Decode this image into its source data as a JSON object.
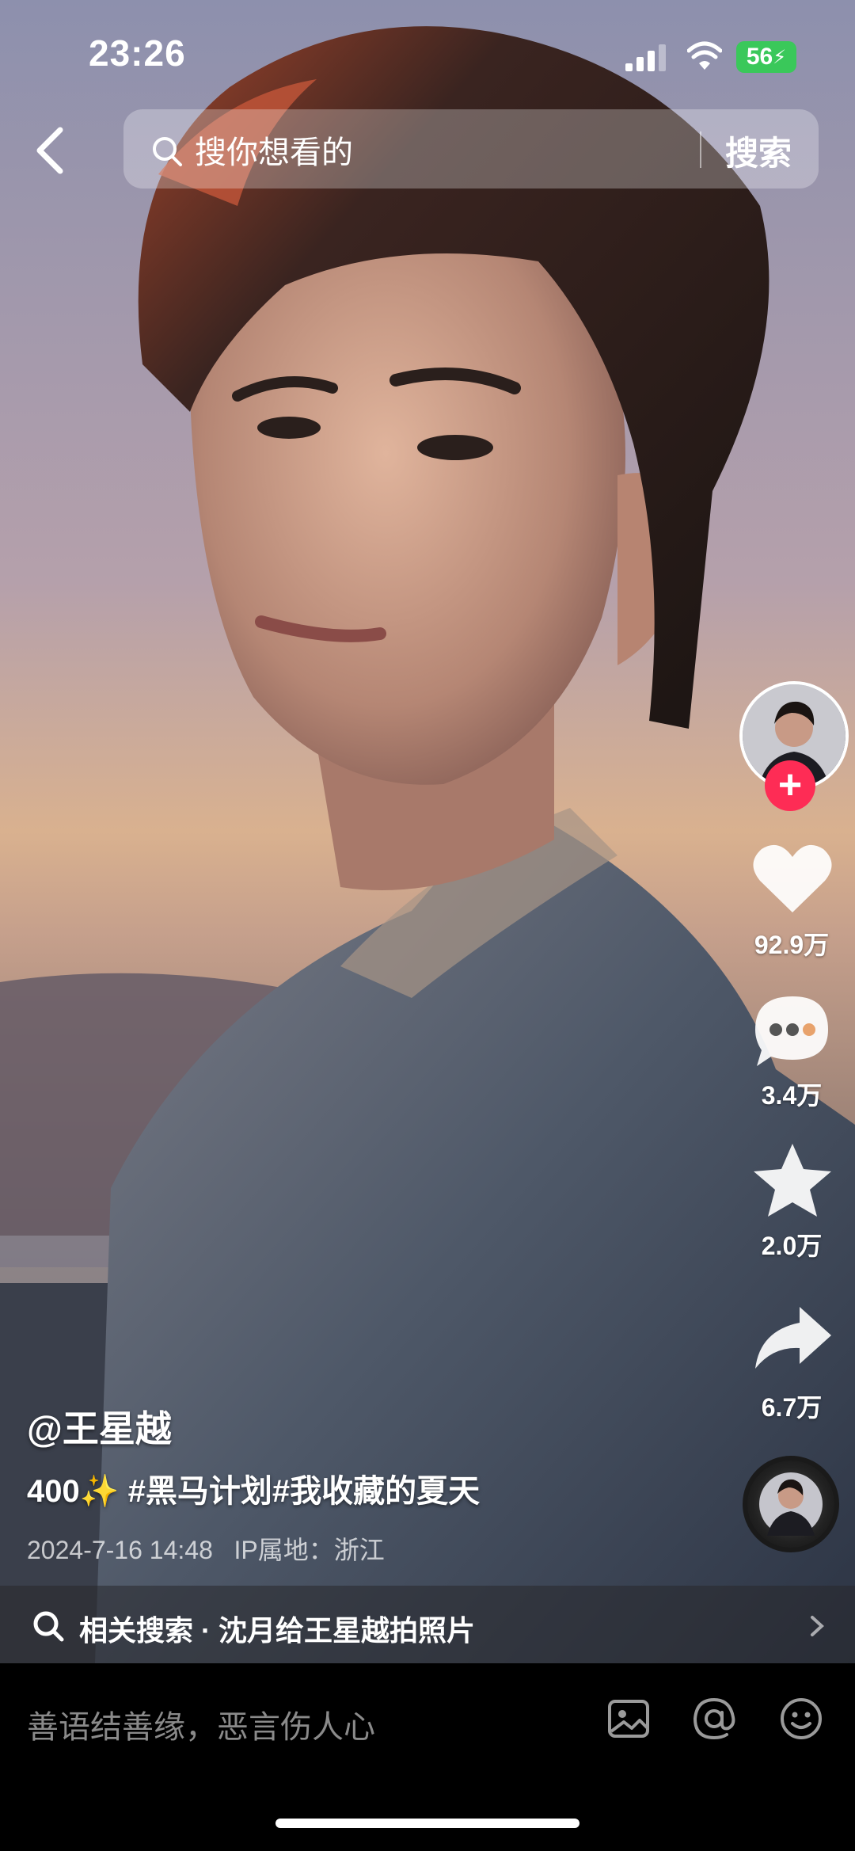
{
  "status_bar": {
    "time": "23:26",
    "battery": "56"
  },
  "search": {
    "placeholder": "搜你想看的",
    "button": "搜索"
  },
  "video": {
    "author": "@王星越",
    "caption": "400✨ #黑马计划#我收藏的夏天",
    "date": "2024-7-16 14:48",
    "ip_location": "IP属地：浙江"
  },
  "actions": {
    "likes": "92.9万",
    "comments": "3.4万",
    "favorites": "2.0万",
    "shares": "6.7万"
  },
  "related_search": {
    "text": "相关搜索 · 沈月给王星越拍照片"
  },
  "comment_bar": {
    "placeholder": "善语结善缘，恶言伤人心"
  }
}
